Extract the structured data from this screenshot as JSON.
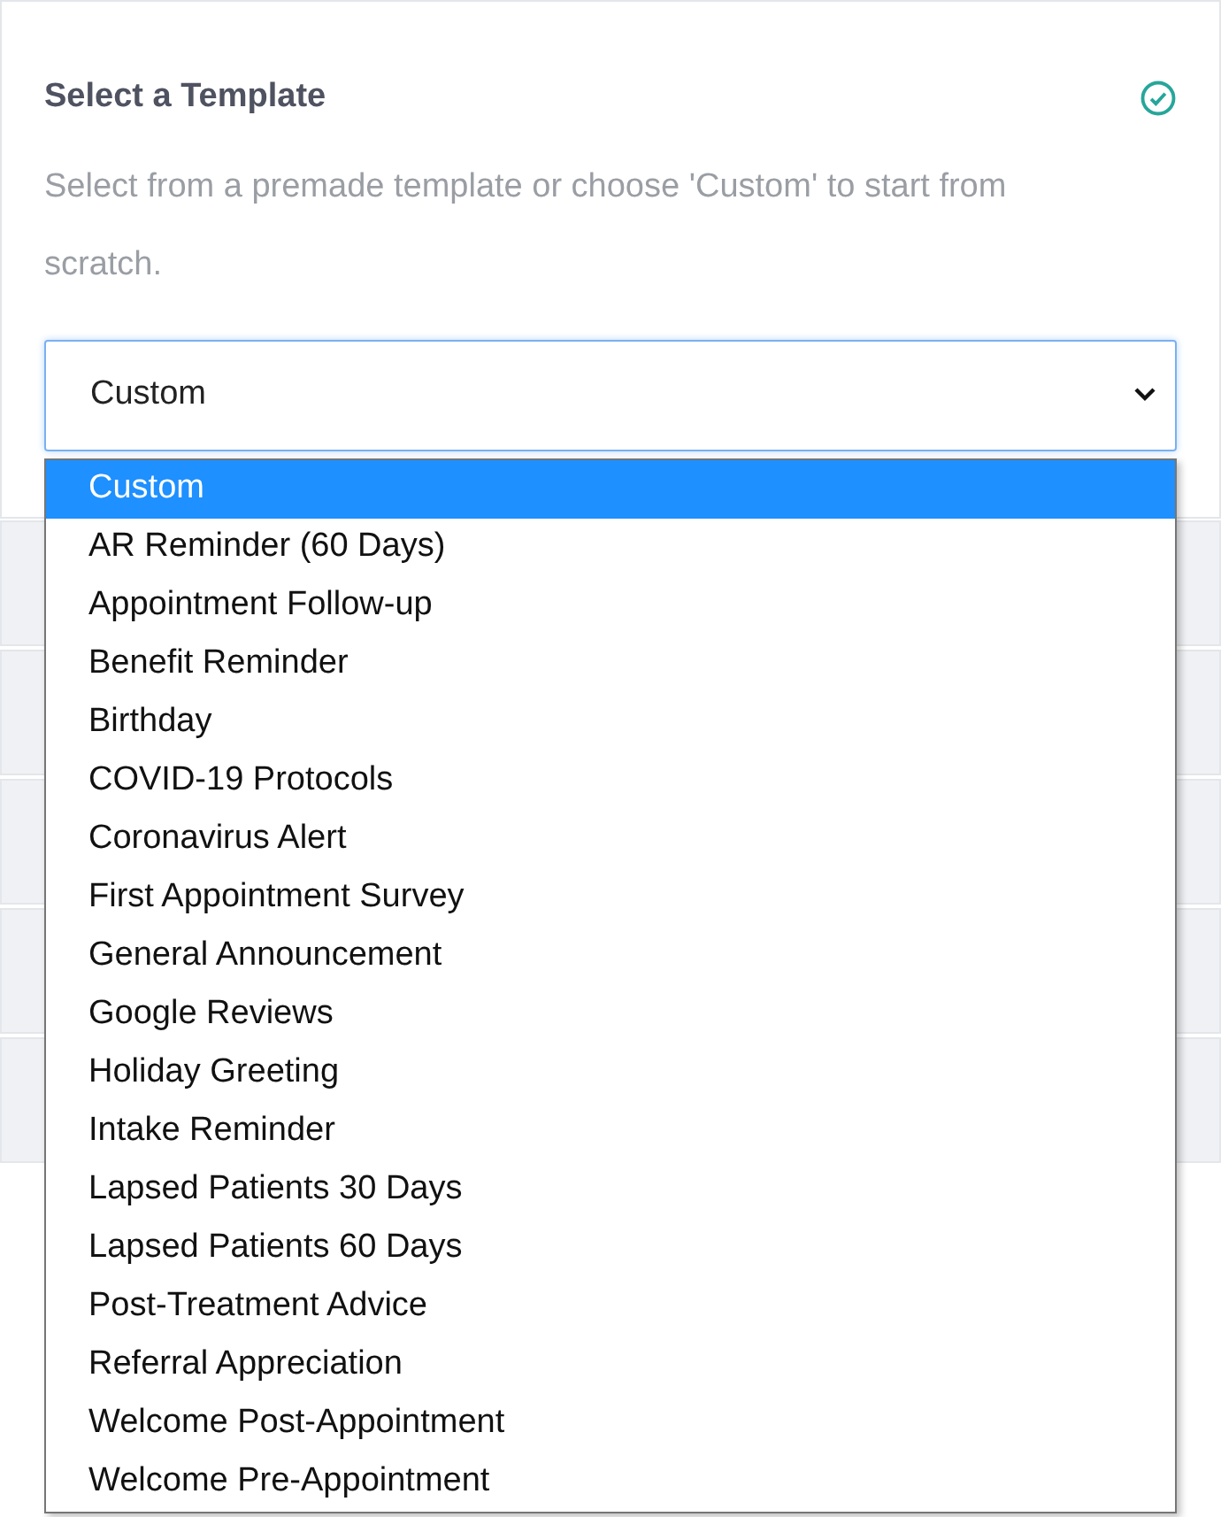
{
  "card": {
    "title": "Select a Template",
    "complete": true,
    "description": "Select from a premade template or choose 'Custom' to start from scratch."
  },
  "select": {
    "value": "Custom",
    "expanded": true,
    "options": [
      {
        "label": "Custom",
        "selected": true
      },
      {
        "label": "AR Reminder (60 Days)",
        "selected": false
      },
      {
        "label": "Appointment Follow-up",
        "selected": false
      },
      {
        "label": "Benefit Reminder",
        "selected": false
      },
      {
        "label": "Birthday",
        "selected": false
      },
      {
        "label": "COVID-19 Protocols",
        "selected": false
      },
      {
        "label": "Coronavirus Alert",
        "selected": false
      },
      {
        "label": "First Appointment Survey",
        "selected": false
      },
      {
        "label": "General Announcement",
        "selected": false
      },
      {
        "label": "Google Reviews",
        "selected": false
      },
      {
        "label": "Holiday Greeting",
        "selected": false
      },
      {
        "label": "Intake Reminder",
        "selected": false
      },
      {
        "label": "Lapsed Patients 30 Days",
        "selected": false
      },
      {
        "label": "Lapsed Patients 60 Days",
        "selected": false
      },
      {
        "label": "Post-Treatment Advice",
        "selected": false
      },
      {
        "label": "Referral Appreciation",
        "selected": false
      },
      {
        "label": "Welcome Post-Appointment",
        "selected": false
      },
      {
        "label": "Welcome Pre-Appointment",
        "selected": false
      }
    ]
  },
  "collapsed_sections": [
    {
      "expanded": false
    },
    {
      "expanded": false
    },
    {
      "expanded": false
    },
    {
      "expanded": false
    },
    {
      "expanded": false
    }
  ]
}
